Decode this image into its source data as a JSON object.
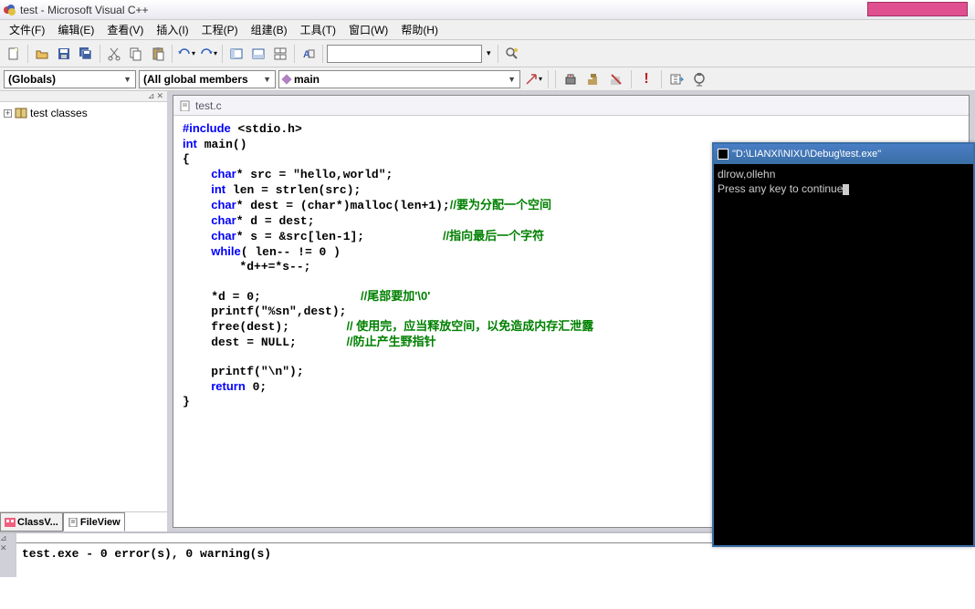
{
  "title": "test - Microsoft Visual C++",
  "menu": [
    "文件(F)",
    "编辑(E)",
    "查看(V)",
    "插入(I)",
    "工程(P)",
    "组建(B)",
    "工具(T)",
    "窗口(W)",
    "帮助(H)"
  ],
  "combos": {
    "globals": "(Globals)",
    "members": "(All global members",
    "main": "main"
  },
  "tree_root": "test classes",
  "tabs": {
    "classview": "ClassV...",
    "fileview": "FileView"
  },
  "editor_tab": "test.c",
  "code_lines": [
    {
      "t": "#include <stdio.h>",
      "kw": [
        "#include"
      ]
    },
    {
      "t": "int main()",
      "kw": [
        "int"
      ]
    },
    {
      "t": "{"
    },
    {
      "t": "    char* src = \"hello,world\";",
      "kw": [
        "char"
      ]
    },
    {
      "t": "    int len = strlen(src);",
      "kw": [
        "int"
      ]
    },
    {
      "t": "    char* dest = (char*)malloc(len+1);//要为分配一个空间",
      "kw": [
        "char",
        "char"
      ],
      "cmt": "//要为分配一个空间"
    },
    {
      "t": "    char* d = dest;",
      "kw": [
        "char"
      ]
    },
    {
      "t": "    char* s = &src[len-1];           //指向最后一个字符",
      "kw": [
        "char"
      ],
      "cmt": "//指向最后一个字符"
    },
    {
      "t": "    while( len-- != 0 )",
      "kw": [
        "while"
      ]
    },
    {
      "t": "        *d++=*s--;"
    },
    {
      "t": ""
    },
    {
      "t": "    *d = 0;              //尾部要加'\\0'",
      "cmt": "//尾部要加'\\0'"
    },
    {
      "t": "    printf(\"%sn\",dest);"
    },
    {
      "t": "    free(dest);        // 使用完，应当释放空间，以免造成内存汇泄露",
      "cmt": "// 使用完，应当释放空间，以免造成内存汇泄露"
    },
    {
      "t": "    dest = NULL;       //防止产生野指针",
      "cmt": "//防止产生野指针"
    },
    {
      "t": ""
    },
    {
      "t": "    printf(\"\\n\");"
    },
    {
      "t": "    return 0;",
      "kw": [
        "return"
      ]
    },
    {
      "t": "}"
    }
  ],
  "console": {
    "title": "\"D:\\LIANXI\\NIXU\\Debug\\test.exe\"",
    "lines": [
      "dlrow,ollehn",
      "Press any key to continue"
    ]
  },
  "output": "test.exe - 0 error(s), 0 warning(s)"
}
